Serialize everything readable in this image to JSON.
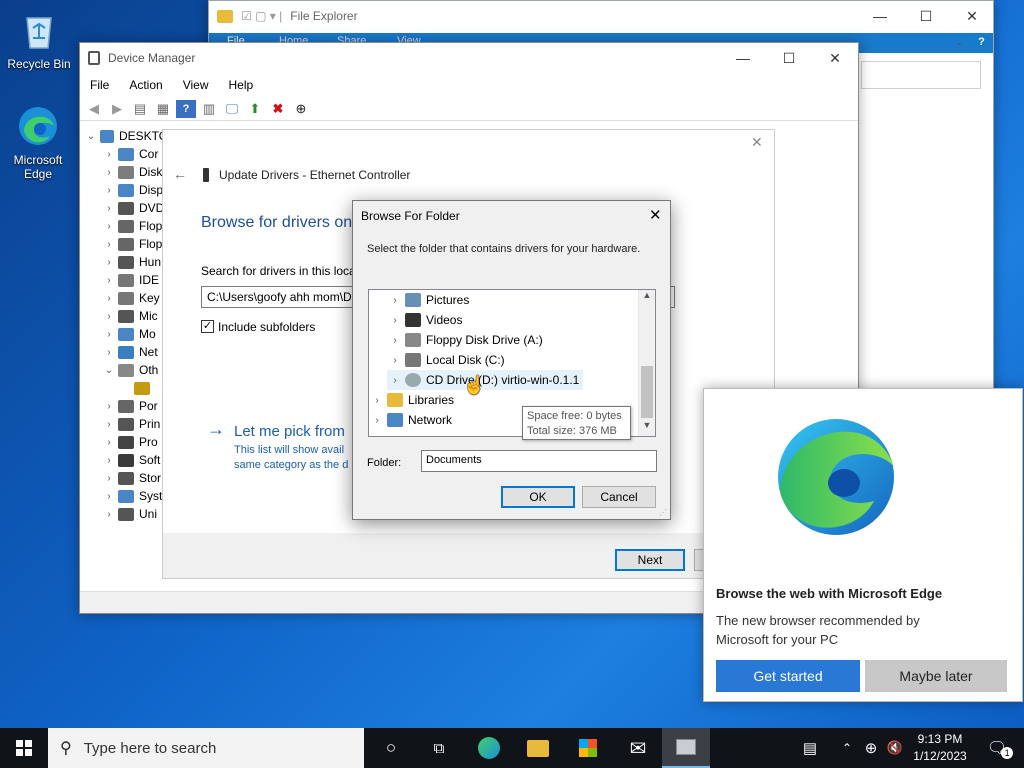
{
  "desktop": {
    "recycle_bin": "Recycle Bin",
    "edge_line1": "Microsoft",
    "edge_line2": "Edge"
  },
  "file_explorer": {
    "title": "File Explorer",
    "tabs": [
      "File",
      "Home",
      "Share",
      "View"
    ]
  },
  "device_manager": {
    "title": "Device Manager",
    "menu": [
      "File",
      "Action",
      "View",
      "Help"
    ],
    "root": "DESKTO",
    "tree": [
      "Cor",
      "Disk",
      "Disp",
      "DVD",
      "Flop",
      "Flop",
      "Hun",
      "IDE",
      "Key",
      "Mic",
      "Mo",
      "Net",
      "Oth",
      "",
      "Por",
      "Prin",
      "Pro",
      "Soft",
      "Stor",
      "Syst",
      "Uni"
    ]
  },
  "update_drivers": {
    "title": "Update Drivers - Ethernet Controller",
    "heading": "Browse for drivers on",
    "search_label": "Search for drivers in this loca",
    "path_value": "C:\\Users\\goofy ahh mom\\D",
    "include_subfolders": "Include subfolders",
    "pick_link": "Let me pick from",
    "pick_desc_1": "This list will show avail",
    "pick_desc_2": "same category as the d",
    "next": "Next"
  },
  "browse_dialog": {
    "title": "Browse For Folder",
    "instruction": "Select the folder that contains drivers for your hardware.",
    "items": [
      {
        "label": "Pictures",
        "indent": 1
      },
      {
        "label": "Videos",
        "indent": 1
      },
      {
        "label": "Floppy Disk Drive (A:)",
        "indent": 1
      },
      {
        "label": "Local Disk (C:)",
        "indent": 1
      },
      {
        "label": "CD Drive (D:) virtio-win-0.1.1",
        "indent": 1
      },
      {
        "label": "Libraries",
        "indent": 0
      },
      {
        "label": "Network",
        "indent": 0
      }
    ],
    "tooltip_line1": "Space free: 0 bytes",
    "tooltip_line2": "Total size: 376 MB",
    "folder_label": "Folder:",
    "folder_value": "Documents",
    "ok": "OK",
    "cancel": "Cancel"
  },
  "edge_popup": {
    "title": "Browse the web with Microsoft Edge",
    "body": "The new browser recommended by Microsoft for your PC",
    "get_started": "Get started",
    "maybe_later": "Maybe later"
  },
  "taskbar": {
    "search_placeholder": "Type here to search",
    "time": "9:13 PM",
    "date": "1/12/2023",
    "notification_count": "1"
  },
  "colors": {
    "accent": "#0078d7",
    "edge_button": "#2a78d5",
    "link_blue": "#1a5fb4"
  }
}
